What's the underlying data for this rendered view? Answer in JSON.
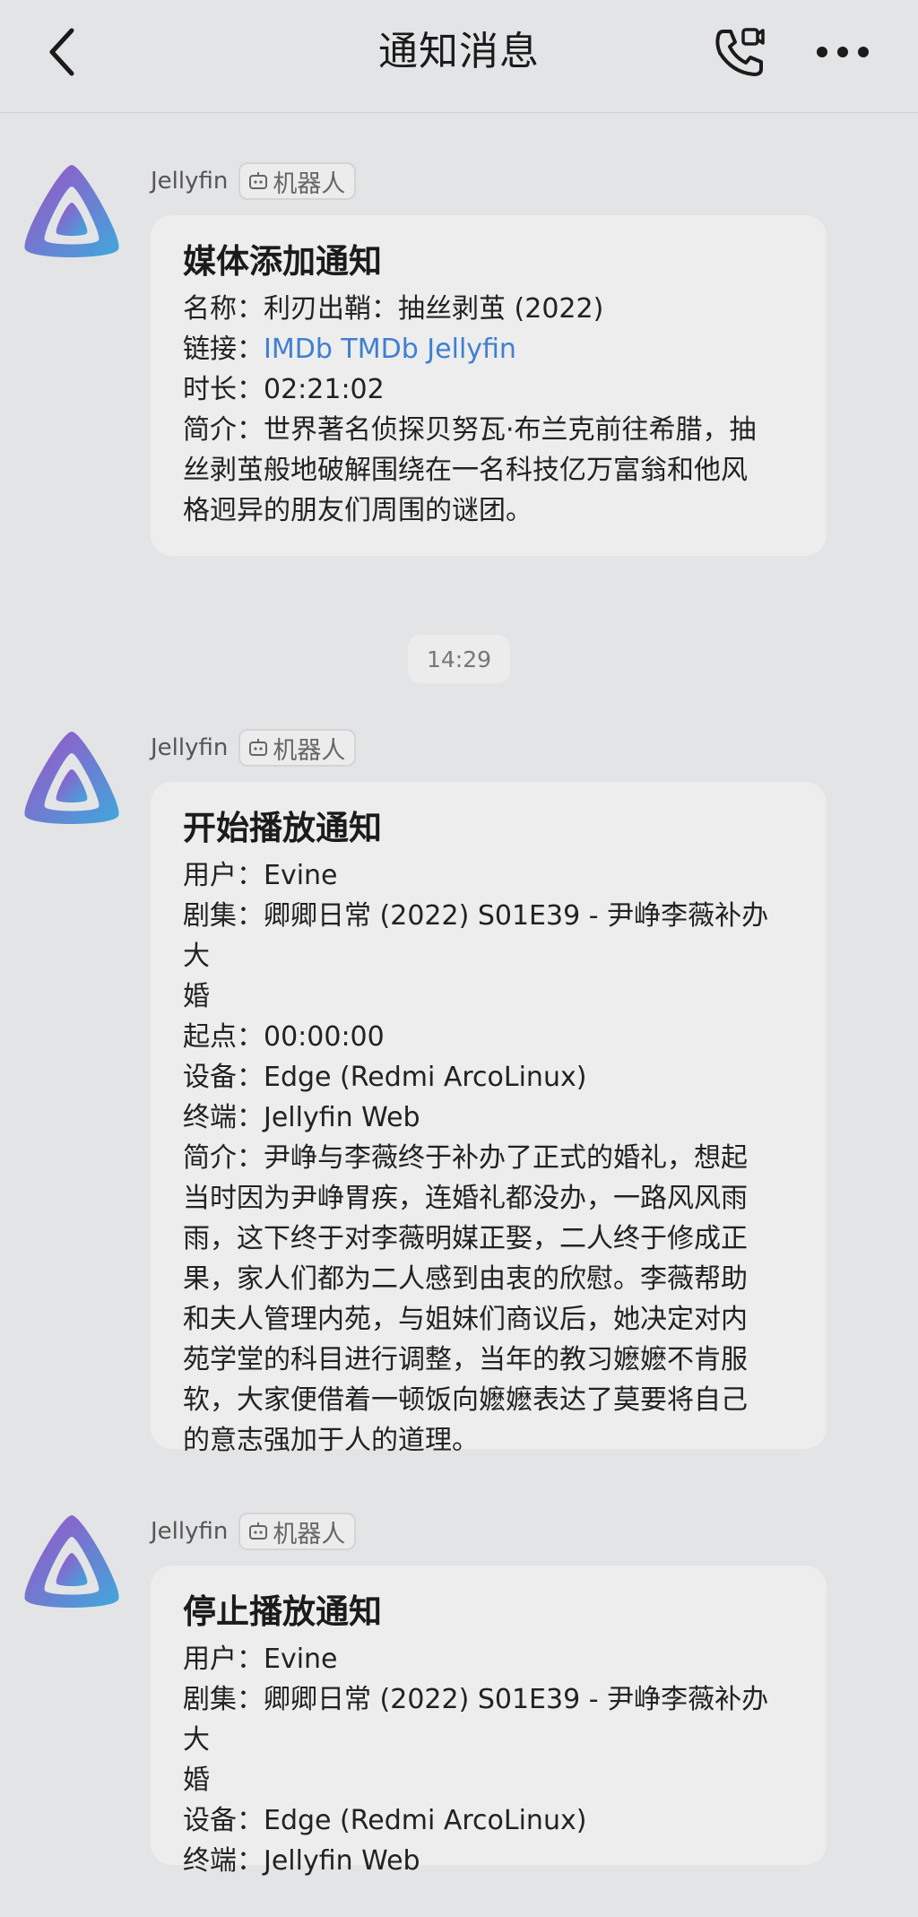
{
  "header": {
    "title": "通知消息",
    "back_icon": "chevron-left-icon",
    "call_icon": "phone-video-icon",
    "more_icon": "more-dots-icon"
  },
  "colors": {
    "background": "#e3e4e6",
    "bubble": "#ededee",
    "link": "#3f7fd1",
    "avatar_gradient_start": "#9b59c7",
    "avatar_gradient_end": "#3fa4d6"
  },
  "time_divider": "14:29",
  "messages": [
    {
      "sender": "Jellyfin",
      "badge": "机器人",
      "title": "媒体添加通知",
      "name_line": "名称：利刃出鞘：抽丝剥茧 (2022)",
      "link_label": "链接：",
      "links": "IMDb TMDb Jellyfin",
      "duration_line": "时长：02:21:02",
      "intro_lines": [
        "简介：世界著名侦探贝努瓦·布兰克前往希腊，抽",
        "丝剥茧般地破解围绕在一名科技亿万富翁和他风",
        "格迥异的朋友们周围的谜团。"
      ]
    },
    {
      "sender": "Jellyfin",
      "badge": "机器人",
      "title": "开始播放通知",
      "lines": [
        "用户：Evine",
        "剧集：卿卿日常 (2022) S01E39 - 尹峥李薇补办大",
        "婚",
        "起点：00:00:00",
        "设备：Edge (Redmi ArcoLinux)",
        "终端：Jellyfin Web",
        "简介：尹峥与李薇终于补办了正式的婚礼，想起",
        "当时因为尹峥胃疾，连婚礼都没办，一路风风雨",
        "雨，这下终于对李薇明媒正娶，二人终于修成正",
        "果，家人们都为二人感到由衷的欣慰。李薇帮助",
        "和夫人管理内苑，与姐妹们商议后，她决定对内",
        "苑学堂的科目进行调整，当年的教习嬷嬷不肯服",
        "软，大家便借着一顿饭向嬷嬷表达了莫要将自己",
        "的意志强加于人的道理。"
      ]
    },
    {
      "sender": "Jellyfin",
      "badge": "机器人",
      "title": "停止播放通知",
      "lines": [
        "用户：Evine",
        "剧集：卿卿日常 (2022) S01E39 - 尹峥李薇补办大",
        "婚",
        "设备：Edge (Redmi ArcoLinux)",
        "终端：Jellyfin Web"
      ]
    }
  ]
}
